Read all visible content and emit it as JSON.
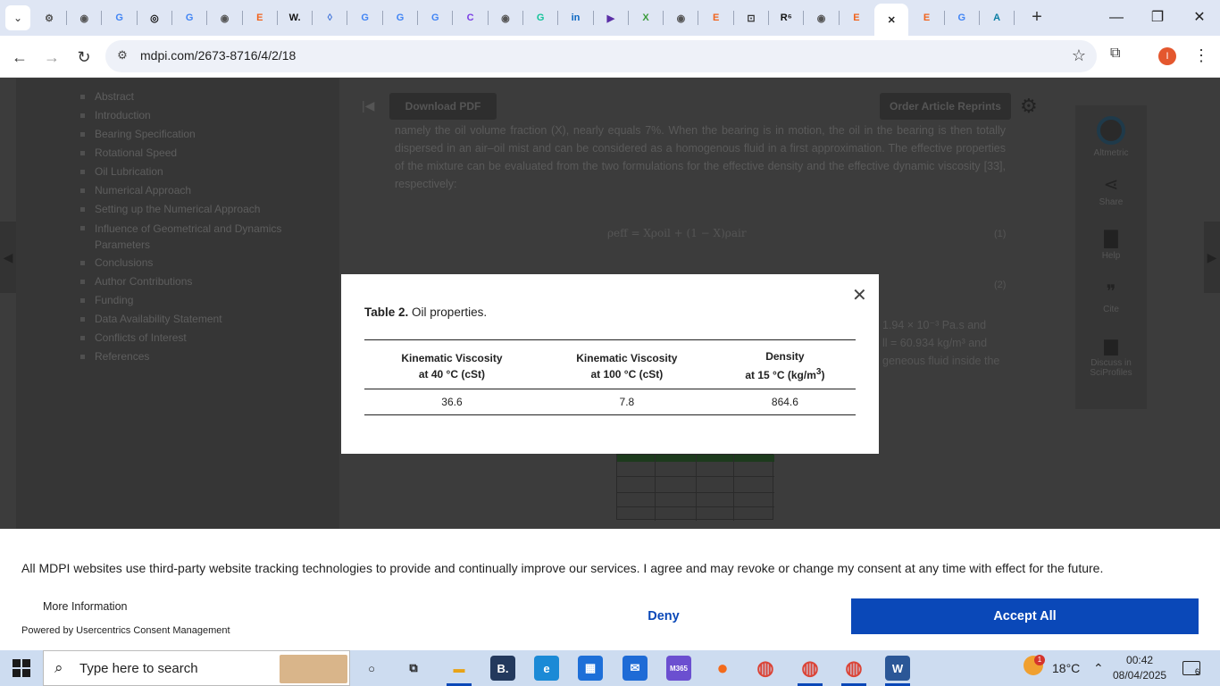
{
  "browser": {
    "tabs": [
      {
        "icon": "gear-favicon-icon",
        "glyph": "⚙",
        "color": "#555"
      },
      {
        "icon": "globe-favicon-icon",
        "glyph": "◉",
        "color": "#555"
      },
      {
        "icon": "google-favicon-icon",
        "glyph": "G",
        "color": "#4285f4"
      },
      {
        "icon": "openai-favicon-icon",
        "glyph": "◎",
        "color": "#111"
      },
      {
        "icon": "google-favicon-icon",
        "glyph": "G",
        "color": "#4285f4"
      },
      {
        "icon": "globe-favicon-icon",
        "glyph": "◉",
        "color": "#555"
      },
      {
        "icon": "etsy-favicon-icon",
        "glyph": "E",
        "color": "#f1641e"
      },
      {
        "icon": "wikipedia-favicon-icon",
        "glyph": "W.",
        "color": "#111"
      },
      {
        "icon": "drop-favicon-icon",
        "glyph": "◊",
        "color": "#3a6fd8"
      },
      {
        "icon": "google-favicon-icon",
        "glyph": "G",
        "color": "#4285f4"
      },
      {
        "icon": "google-favicon-icon",
        "glyph": "G",
        "color": "#4285f4"
      },
      {
        "icon": "google-favicon-icon",
        "glyph": "G",
        "color": "#4285f4"
      },
      {
        "icon": "copilot-favicon-icon",
        "glyph": "C",
        "color": "#7b3fe4"
      },
      {
        "icon": "globe-favicon-icon",
        "glyph": "◉",
        "color": "#555"
      },
      {
        "icon": "grammarly-favicon-icon",
        "glyph": "G",
        "color": "#15c39a"
      },
      {
        "icon": "linkedin-favicon-icon",
        "glyph": "in",
        "color": "#0a66c2"
      },
      {
        "icon": "player-favicon-icon",
        "glyph": "▶",
        "color": "#5b2ea6"
      },
      {
        "icon": "sheet-favicon-icon",
        "glyph": "X",
        "color": "#3a9a3a"
      },
      {
        "icon": "globe-favicon-icon",
        "glyph": "◉",
        "color": "#555"
      },
      {
        "icon": "etsy-favicon-icon",
        "glyph": "E",
        "color": "#f1641e"
      },
      {
        "icon": "lock-favicon-icon",
        "glyph": "⊡",
        "color": "#333"
      },
      {
        "icon": "researchgate-favicon-icon",
        "glyph": "R⁶",
        "color": "#111"
      },
      {
        "icon": "globe-favicon-icon",
        "glyph": "◉",
        "color": "#555"
      },
      {
        "icon": "etsy-favicon-icon",
        "glyph": "E",
        "color": "#f1641e"
      },
      {
        "icon": "close-icon",
        "glyph": "✕",
        "color": "#222",
        "active": true
      },
      {
        "icon": "etsy-favicon-icon",
        "glyph": "E",
        "color": "#f1641e"
      },
      {
        "icon": "google-favicon-icon",
        "glyph": "G",
        "color": "#4285f4"
      },
      {
        "icon": "app-favicon-icon",
        "glyph": "A",
        "color": "#0a7ea4"
      }
    ],
    "url": "mdpi.com/2673-8716/4/2/18"
  },
  "page": {
    "toc": [
      "Abstract",
      "Introduction",
      "Bearing Specification",
      "Rotational Speed",
      "Oil Lubrication",
      "Numerical Approach",
      "Setting up the Numerical Approach",
      "Influence of Geometrical and Dynamics Parameters",
      "Conclusions",
      "Author Contributions",
      "Funding",
      "Data Availability Statement",
      "Conflicts of Interest",
      "References"
    ],
    "download_pdf": "Download PDF",
    "order_reprints": "Order Article Reprints",
    "article_text": "namely the oil volume fraction (X), nearly equals 7%. When the bearing is in motion, the oil in the bearing is then totally dispersed in an air–oil mist and can be considered as a homogenous fluid in a first approximation. The effective properties of the mixture can be evaluated from the two formulations for the effective density and the effective dynamic viscosity [33], respectively:",
    "equation1": "ρeff = Xρoil + (1 − X)ρair",
    "equation1_num": "(1)",
    "equation2_num": "(2)",
    "right_fragment_1": "1.94 × 10⁻³  Pa.s  and",
    "right_fragment_2": "ll = 60.934  kg/m³  and",
    "right_fragment_3": "geneous fluid inside the",
    "rail": {
      "altmetric": "Altmetric",
      "share": "Share",
      "help": "Help",
      "cite": "Cite",
      "discuss": "Discuss in SciProfiles"
    }
  },
  "modal": {
    "caption_label": "Table 2.",
    "caption_text": "Oil properties.",
    "headers": [
      {
        "line1": "Kinematic Viscosity",
        "line2": "at 40 °C (cSt)"
      },
      {
        "line1": "Kinematic Viscosity",
        "line2": "at 100 °C (cSt)"
      },
      {
        "line1": "Density",
        "line2": "at 15 °C (kg/m",
        "sup": "3",
        "tail": ")"
      }
    ],
    "row": [
      "36.6",
      "7.8",
      "864.6"
    ]
  },
  "consent": {
    "text": "All MDPI websites use third-party website tracking technologies to provide and continually improve our services. I agree and may revoke or change my consent at any time with effect for the future.",
    "more_info": "More Information",
    "powered_by": "Powered by Usercentrics Consent Management",
    "deny": "Deny",
    "accept": "Accept All",
    "accent": "#0a48b8"
  },
  "taskbar": {
    "search_placeholder": "Type here to search",
    "temperature": "18°C",
    "time": "00:42",
    "date": "08/04/2025",
    "weather_badge": "1",
    "notif_count": "6",
    "apps": [
      {
        "icon": "cortana-icon",
        "glyph": "○",
        "color": "#222",
        "bg": "transparent"
      },
      {
        "icon": "task-view-icon",
        "glyph": "⧉",
        "color": "#222",
        "bg": "transparent"
      },
      {
        "icon": "file-explorer-icon",
        "glyph": "▬",
        "color": "#e8a317",
        "bg": "transparent"
      },
      {
        "icon": "booking-app-icon",
        "glyph": "B.",
        "color": "#fff",
        "bg": "#23395d"
      },
      {
        "icon": "edge-icon",
        "glyph": "e",
        "color": "#fff",
        "bg": "#1b8ad6"
      },
      {
        "icon": "store-icon",
        "glyph": "▦",
        "color": "#fff",
        "bg": "#1d6fd8"
      },
      {
        "icon": "mail-icon",
        "glyph": "✉",
        "color": "#fff",
        "bg": "#1e6bd6"
      },
      {
        "icon": "m365-icon",
        "glyph": "M365",
        "color": "#fff",
        "bg": "#6b4fd0"
      },
      {
        "icon": "firefox-icon",
        "glyph": "●",
        "color": "#f36b1c",
        "bg": "transparent"
      },
      {
        "icon": "chrome-icon",
        "glyph": "◍",
        "color": "#db4437",
        "bg": "transparent"
      },
      {
        "icon": "chrome-profile-icon",
        "glyph": "◍",
        "color": "#db4437",
        "bg": "transparent"
      },
      {
        "icon": "chrome-active-icon",
        "glyph": "◍",
        "color": "#db4437",
        "bg": "transparent"
      },
      {
        "icon": "word-icon",
        "glyph": "W",
        "color": "#fff",
        "bg": "#2b5797"
      }
    ]
  }
}
